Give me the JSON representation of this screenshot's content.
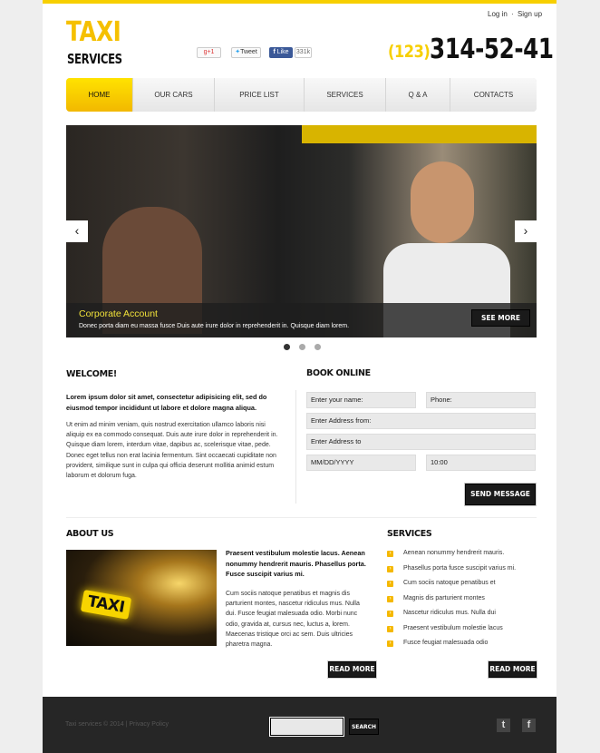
{
  "header": {
    "login": "Log in",
    "separator": "·",
    "signup": "Sign up",
    "logo_top": "TAXI",
    "logo_bottom": "SERVICES",
    "social": {
      "gplus": "g+1",
      "tweet": "Tweet",
      "like": "Like",
      "like_count": "331k"
    },
    "phone_code": "(123)",
    "phone_number": "314-52-41"
  },
  "nav": [
    {
      "label": "HOME",
      "active": true
    },
    {
      "label": "OUR CARS"
    },
    {
      "label": "PRICE LIST"
    },
    {
      "label": "SERVICES"
    },
    {
      "label": "Q & A"
    },
    {
      "label": "CONTACTS"
    }
  ],
  "slider": {
    "title": "Corporate Account",
    "text": "Donec porta diam eu massa fusce  Duis aute irure dolor in reprehenderit in. Quisque diam lorem.",
    "button": "SEE MORE",
    "prev": "‹",
    "next": "›",
    "dots": 3,
    "active_dot": 1
  },
  "welcome": {
    "title": "WELCOME!",
    "lead": "Lorem ipsum dolor sit amet, consectetur adipisicing elit, sed do eiusmod tempor incididunt ut labore et dolore magna aliqua.",
    "body": "Ut enim ad minim veniam, quis nostrud exercitation ullamco laboris nisi aliquip ex ea commodo consequat. Duis aute irure dolor in reprehenderit in. Quisque diam lorem, interdum vitae, dapibus ac, scelerisque vitae, pede. Donec eget tellus non erat lacinia fermentum. Sint occaecati cupiditate non provident, similique sunt in culpa qui officia deserunt mollitia animid estum laborum et dolorum fuga."
  },
  "booking": {
    "title": "BOOK ONLINE",
    "name": "Enter your name:",
    "phone": "Phone:",
    "from": "Enter Address from:",
    "to": "Enter Address to",
    "date": "MM/DD/YYYY",
    "time": "10:00",
    "submit": "SEND MESSAGE"
  },
  "about": {
    "title": "ABOUT US",
    "image_sign": "TAXI",
    "lead": "Praesent vestibulum molestie lacus. Aenean nonummy hendrerit mauris. Phasellus porta. Fusce suscipit varius mi.",
    "body": "Cum sociis natoque penatibus et magnis dis parturient montes, nascetur ridiculus mus. Nulla dui. Fusce feugiat malesuada odio. Morbi nunc odio, gravida at, cursus nec, luctus a, lorem. Maecenas tristique orci ac sem. Duis ultricies pharetra magna.",
    "button": "READ MORE"
  },
  "services": {
    "title": "SERVICES",
    "items": [
      "Aenean nonummy hendrerit mauris.",
      "Phasellus porta fusce suscipit varius mi.",
      "Cum sociis natoque penatibus et",
      "Magnis dis parturient montes",
      "Nascetur ridiculus mus. Nulla dui",
      "Praesent vestibulum molestie lacus",
      "Fusce feugiat malesuada odio"
    ],
    "button": "READ MORE"
  },
  "footer": {
    "copyright": "Taxi services © 2014 | Privacy Policy",
    "search_button": "SEARCH",
    "search_value": "",
    "twitter": "t",
    "facebook": "f"
  },
  "colors": {
    "accent": "#f7cf00",
    "dark": "#1a1a1a",
    "footer": "#262626"
  }
}
